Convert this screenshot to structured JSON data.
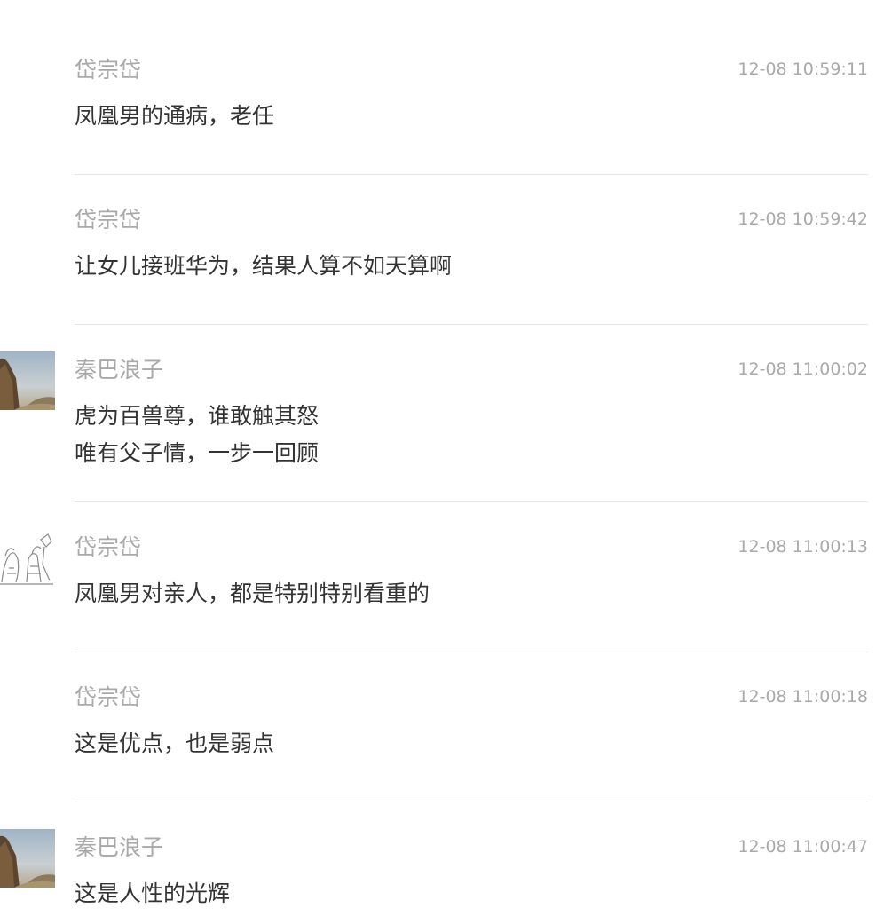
{
  "comments": [
    {
      "username": "岱宗岱",
      "time": "12-08 10:59:11",
      "lines": [
        "凤凰男的通病，老任"
      ]
    },
    {
      "username": "岱宗岱",
      "time": "12-08 10:59:42",
      "lines": [
        "让女儿接班华为，结果人算不如天算啊"
      ]
    },
    {
      "username": "秦巴浪子",
      "time": "12-08 11:00:02",
      "lines": [
        "虎为百兽尊，谁敢触其怒",
        "唯有父子情，一步一回顾"
      ],
      "avatar": "landscape-photo"
    },
    {
      "username": "岱宗岱",
      "time": "12-08 11:00:13",
      "lines": [
        "凤凰男对亲人，都是特别特别看重的"
      ],
      "avatar": "sketch-drawing"
    },
    {
      "username": "岱宗岱",
      "time": "12-08 11:00:18",
      "lines": [
        "这是优点，也是弱点"
      ]
    },
    {
      "username": "秦巴浪子",
      "time": "12-08 11:00:47",
      "lines": [
        "这是人性的光辉"
      ],
      "avatar": "landscape-photo"
    }
  ]
}
